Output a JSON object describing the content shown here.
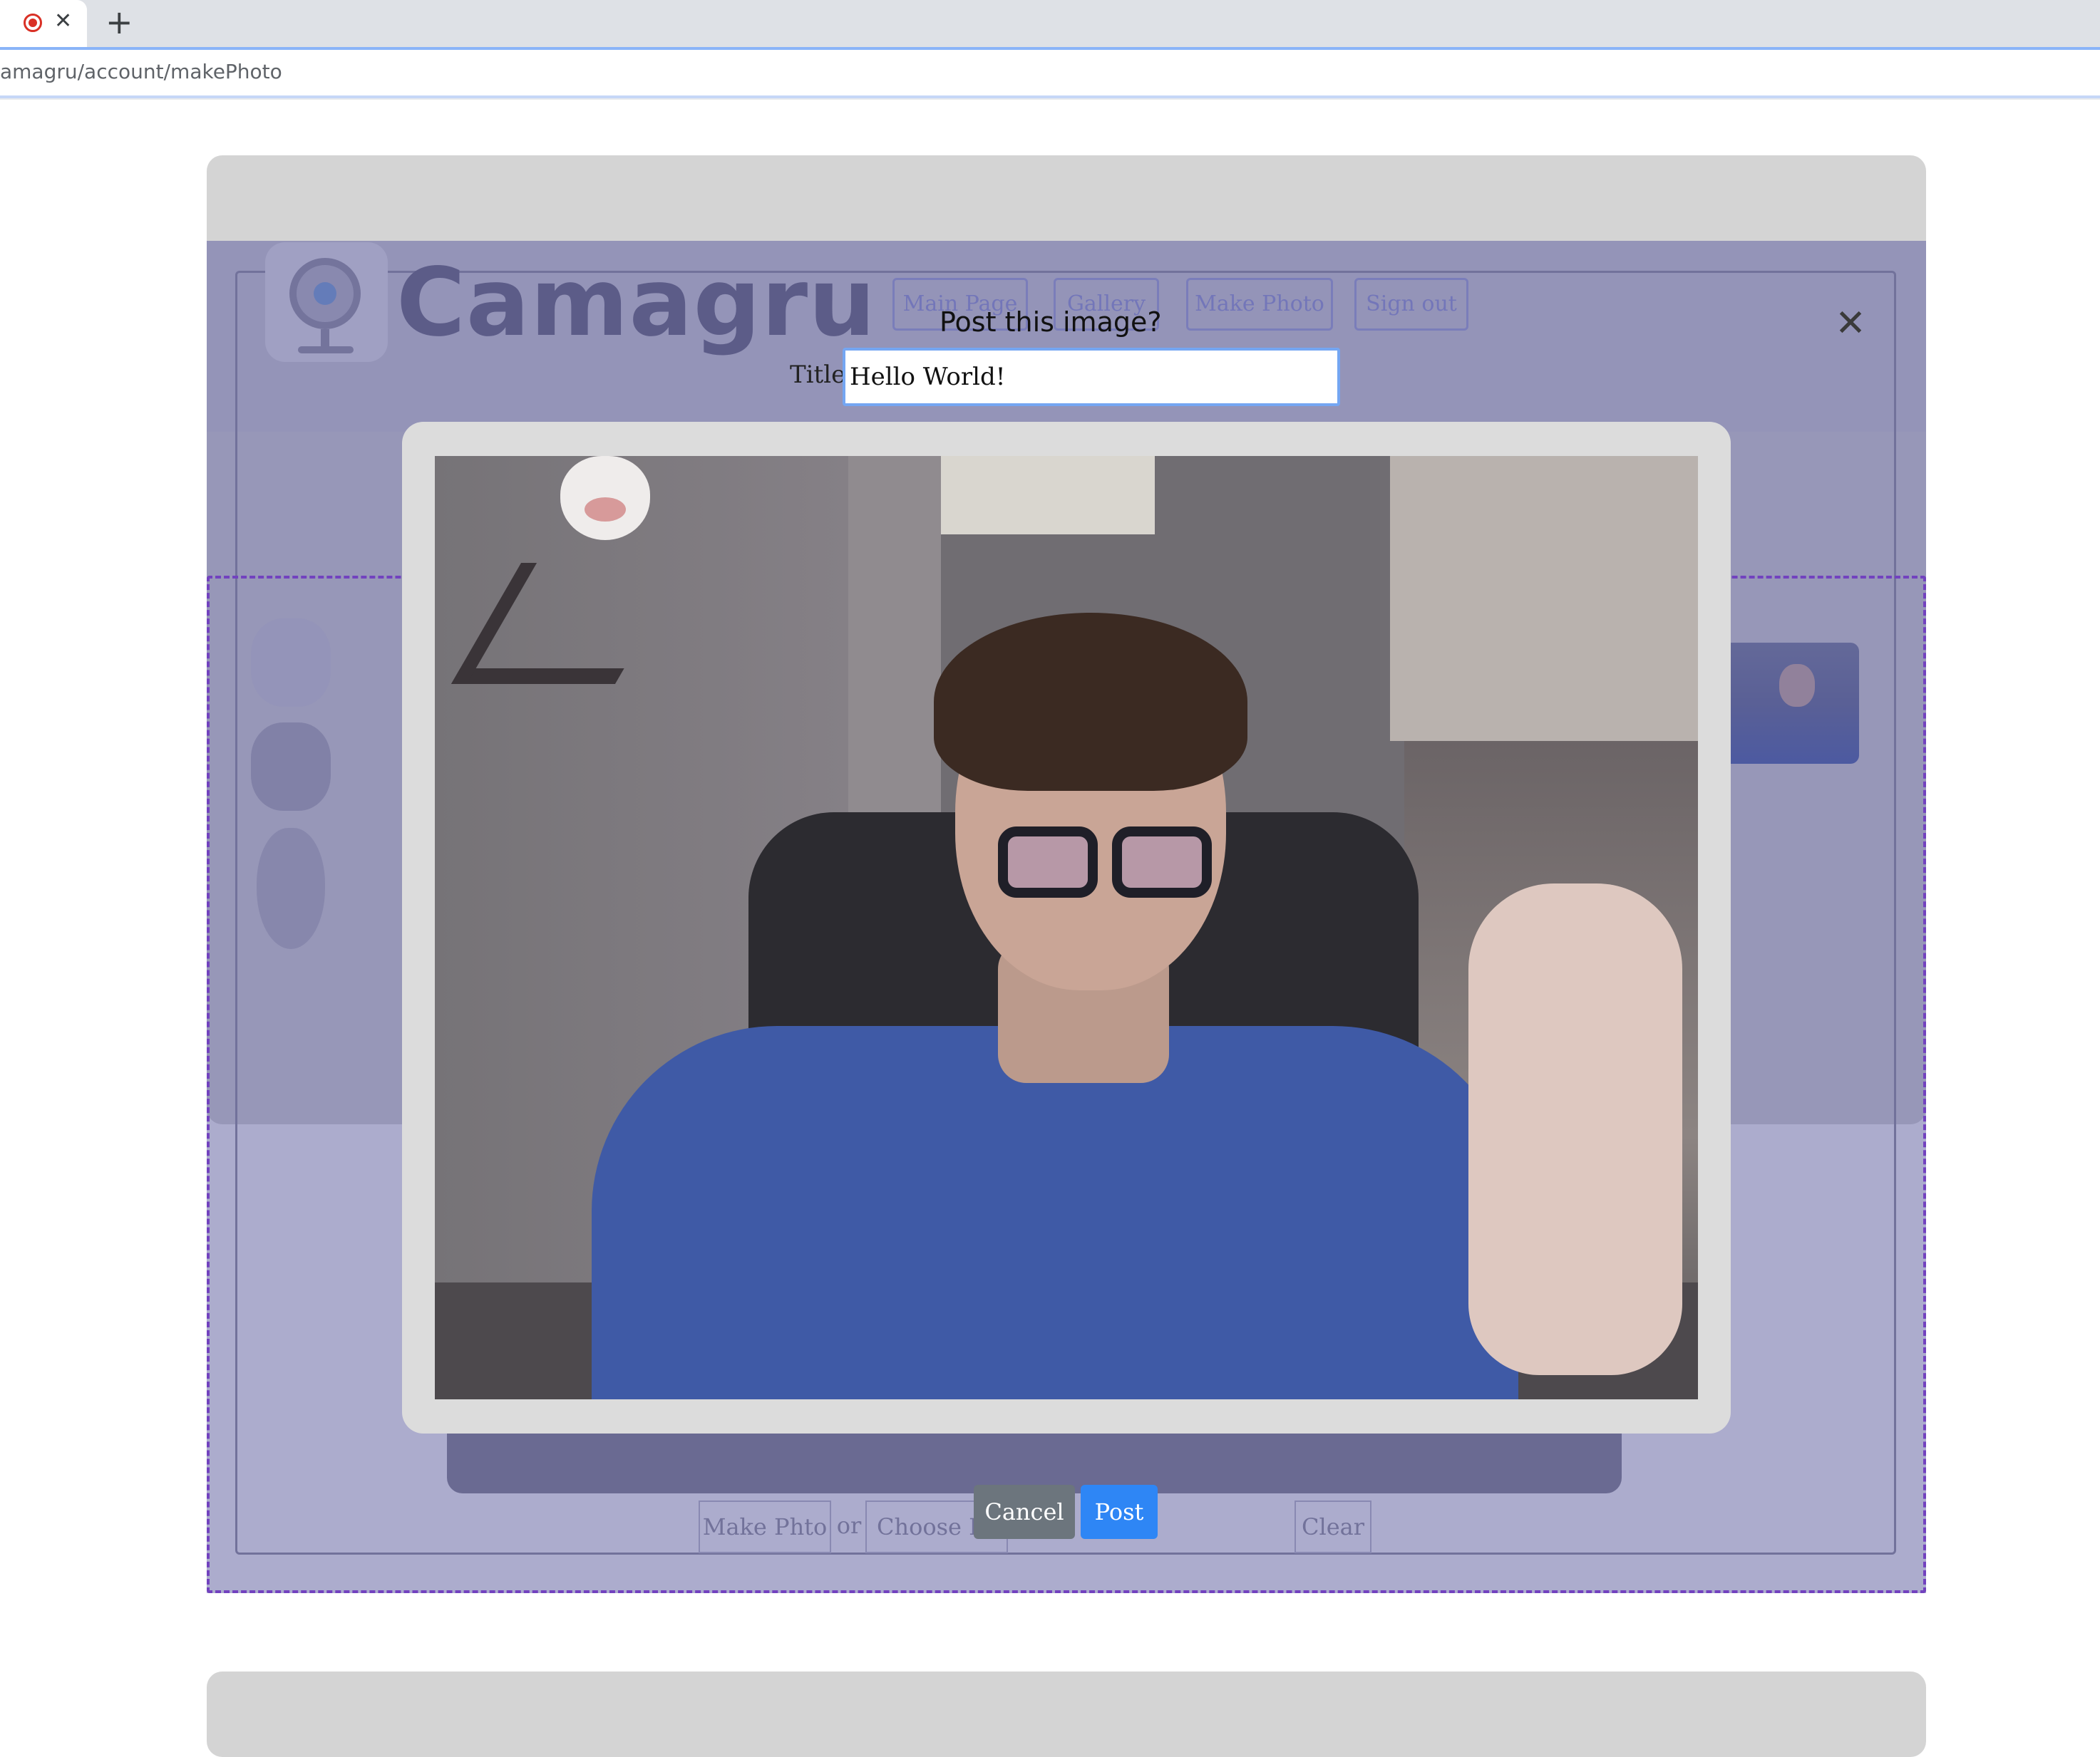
{
  "browser": {
    "tab_close": "✕",
    "new_tab": "+",
    "url": "amagru/account/makePhoto"
  },
  "app": {
    "logo_text": "Camagru",
    "nav": [
      "Main Page",
      "Gallery",
      "Make Photo",
      "Sign out"
    ],
    "controls": {
      "make_photo": "Make Phto",
      "or": "or",
      "choose_file": "Choose File",
      "clear": "Clear"
    }
  },
  "modal": {
    "title": "Post this image?",
    "title_label": "Title",
    "title_value": "Hello World!",
    "close": "✕",
    "cancel_label": "Cancel",
    "post_label": "Post"
  },
  "colors": {
    "post_button": "#2e86f5",
    "cancel_button": "#6c757d",
    "overlay": "#5a5a9b",
    "dropzone_border": "#8a2be2"
  }
}
